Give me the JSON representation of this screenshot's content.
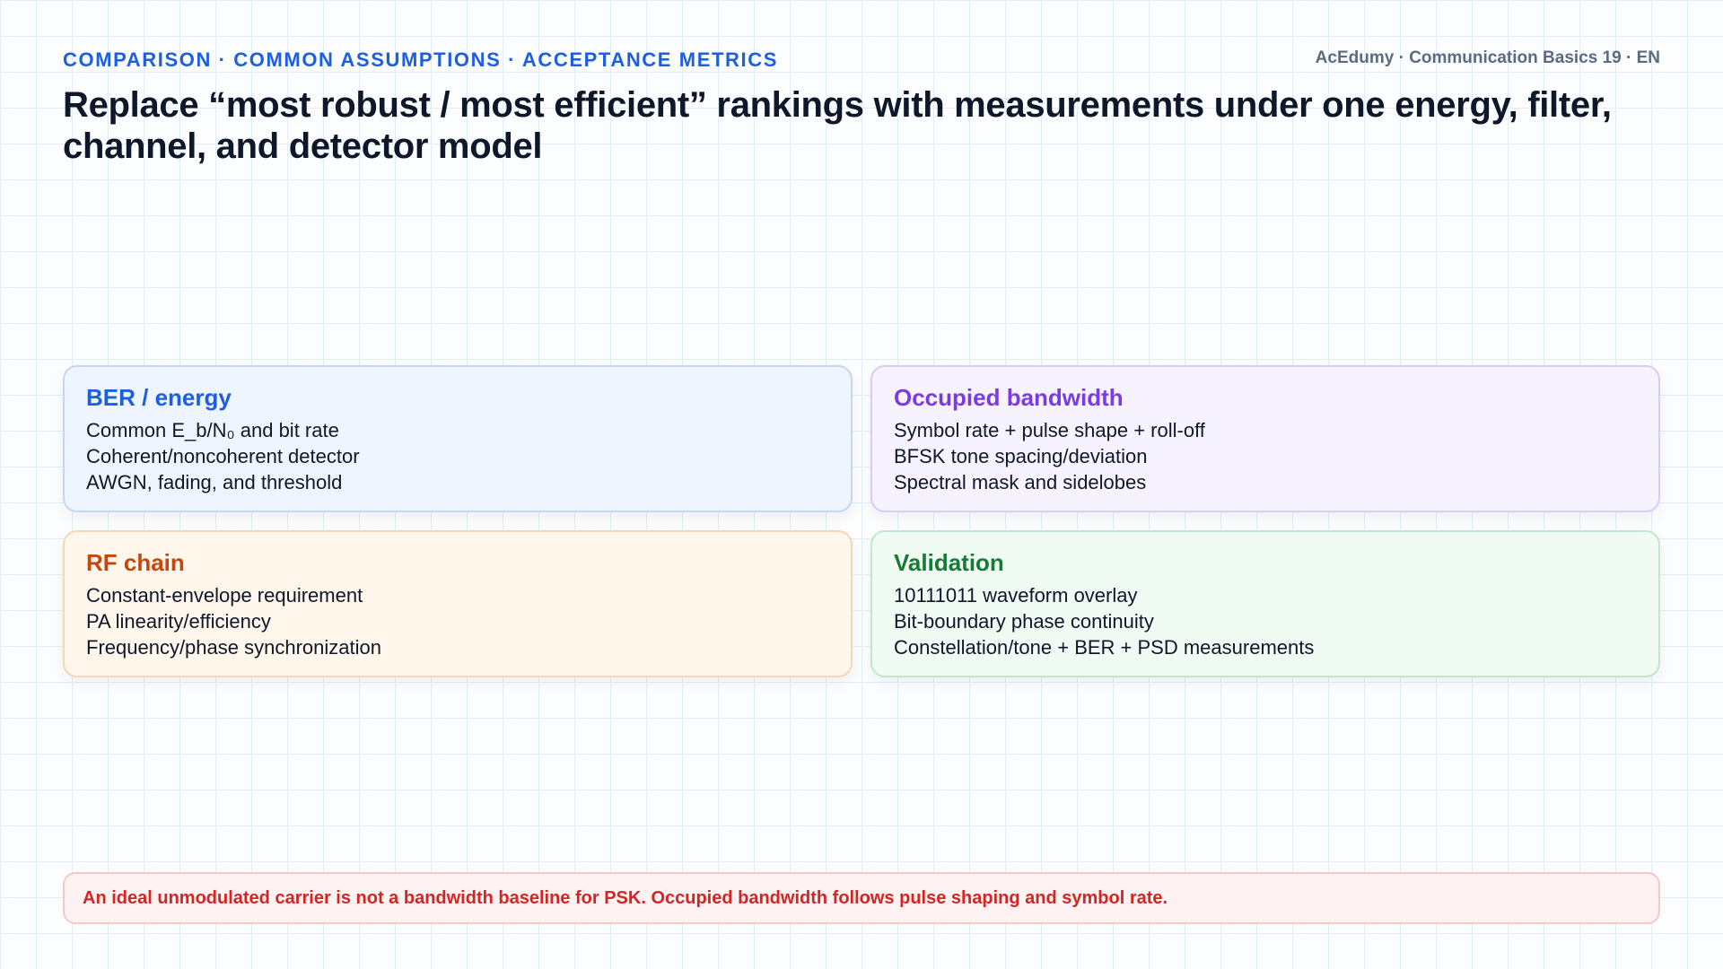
{
  "header": {
    "kicker": "COMPARISON · COMMON ASSUMPTIONS · ACCEPTANCE METRICS",
    "brand": "AcEdumy · Communication Basics 19 · EN",
    "title": "Replace “most robust / most efficient” rankings with measurements under one energy, filter, channel, and detector model"
  },
  "cards": [
    {
      "title": "BER / energy",
      "accent": "#1d5fe0",
      "lines": [
        "Common E_b/N₀ and bit rate",
        "Coherent/noncoherent detector",
        "AWGN, fading, and threshold"
      ]
    },
    {
      "title": "Occupied bandwidth",
      "accent": "#7a3be3",
      "lines": [
        "Symbol rate + pulse shape + roll-off",
        "BFSK tone spacing/deviation",
        "Spectral mask and sidelobes"
      ]
    },
    {
      "title": "RF chain",
      "accent": "#c4470d",
      "lines": [
        "Constant-envelope requirement",
        "PA linearity/efficiency",
        "Frequency/phase synchronization"
      ]
    },
    {
      "title": "Validation",
      "accent": "#177a35",
      "lines": [
        "10111011 waveform overlay",
        "Bit-boundary phase continuity",
        "Constellation/tone + BER + PSD measurements"
      ]
    }
  ],
  "notice": {
    "text": "An ideal unmodulated carrier is not a bandwidth baseline for PSK. Occupied bandwidth follows pulse shaping and symbol rate.",
    "color": "#d42525"
  }
}
